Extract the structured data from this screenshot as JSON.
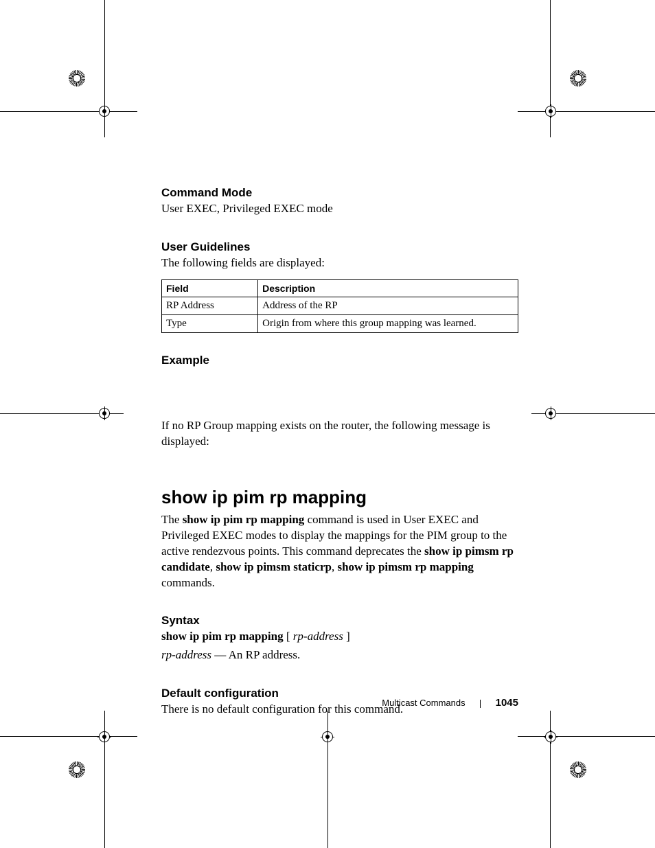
{
  "sections": {
    "command_mode": {
      "heading": "Command Mode",
      "text": "User EXEC, Privileged EXEC mode"
    },
    "user_guidelines": {
      "heading": "User Guidelines",
      "text": "The following fields are displayed:"
    },
    "table": {
      "head_field": "Field",
      "head_desc": "Description",
      "rows": [
        {
          "field": "RP Address",
          "desc": "Address of the RP"
        },
        {
          "field": "Type",
          "desc": "Origin from where this group mapping was learned."
        }
      ]
    },
    "example": {
      "heading": "Example",
      "text": "If no RP Group mapping exists on the router, the following message is displayed:"
    },
    "main": {
      "heading": "show ip pim rp mapping",
      "para_pre": "The ",
      "para_cmd": "show ip pim rp mapping",
      "para_mid": " command is used in User EXEC and Privileged EXEC modes to display the mappings for the PIM group to the active rendezvous points. This command deprecates the ",
      "para_b1": "show ip pimsm rp candidate",
      "para_sep1": ", ",
      "para_b2": "show ip pimsm staticrp",
      "para_sep2": ", ",
      "para_b3": "show ip pimsm rp mapping",
      "para_post": " commands."
    },
    "syntax": {
      "heading": "Syntax",
      "line1_cmd": "show ip pim rp mapping",
      "line1_br_open": " [ ",
      "line1_arg": "rp-address",
      "line1_br_close": " ]",
      "line2_arg": "rp-address",
      "line2_rest": " — An RP address."
    },
    "default_cfg": {
      "heading": "Default configuration",
      "text": "There is no default configuration for this command."
    }
  },
  "footer": {
    "section": "Multicast Commands",
    "page": "1045"
  }
}
